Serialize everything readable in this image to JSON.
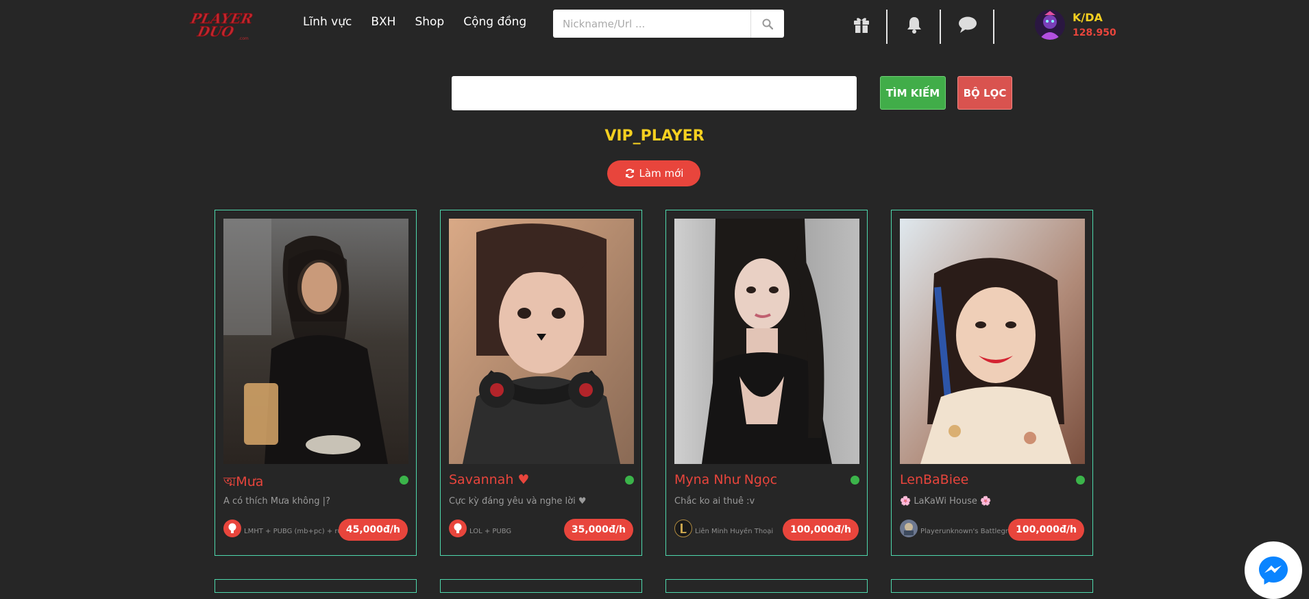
{
  "header": {
    "logo_text": "PlayerDuo",
    "nav": [
      "Lĩnh vực",
      "BXH",
      "Shop",
      "Cộng đồng"
    ],
    "search_placeholder": "Nickname/Url ...",
    "user_name": "K/DA",
    "user_balance": "128.950"
  },
  "filter": {
    "search_value": "",
    "find_label": "TÌM KIẾM",
    "filter_label": "BỘ LỌC"
  },
  "section_title": "VIP_PLAYER",
  "refresh_label": "Làm mới",
  "players": [
    {
      "name": "ত্মMưa",
      "desc": "A có thích Mưa không |?",
      "game": "LMHT + PUBG (mb+pc) + rules",
      "price": "45,000đ/h",
      "online": true
    },
    {
      "name": "Savannah ♥",
      "desc": "Cực kỳ đáng yêu và nghe lời ♥",
      "game": "LOL + PUBG",
      "price": "35,000đ/h",
      "online": true
    },
    {
      "name": "Myna Như Ngọc",
      "desc": "Chắc ko ai thuê :v",
      "game": "Liên Minh Huyền Thoại",
      "price": "100,000đ/h",
      "online": true
    },
    {
      "name": "LenBaBiee",
      "desc": "🌸 LaKaWi House 🌸",
      "game": "Playerunknown's Battlegrounds",
      "price": "100,000đ/h",
      "online": true
    }
  ],
  "colors": {
    "background": "#262626",
    "accent_red": "#e8453c",
    "accent_yellow": "#f5d020",
    "card_border": "#4fd9ad",
    "green_button": "#41ad49",
    "online": "#3bb44a"
  },
  "icons": [
    "gift-icon",
    "bell-icon",
    "chat-icon",
    "search-icon",
    "refresh-icon",
    "messenger-icon",
    "bulb-icon",
    "lol-icon",
    "pubg-icon"
  ]
}
